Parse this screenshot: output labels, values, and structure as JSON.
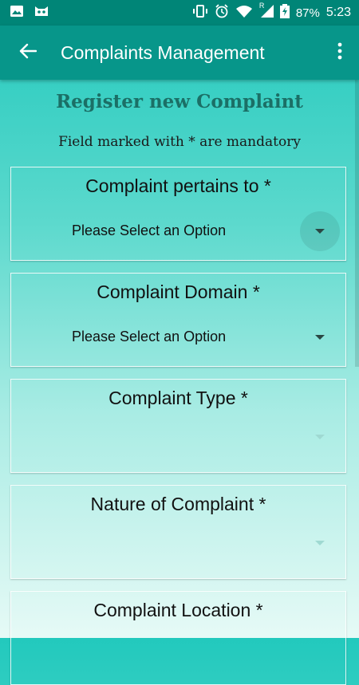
{
  "status_bar": {
    "battery": "87%",
    "time": "5:23",
    "signal_label": "R",
    "icons": [
      "image-icon",
      "cat-app-icon",
      "vibrate-icon",
      "alarm-icon",
      "wifi-icon",
      "signal-icon",
      "battery-charging-icon"
    ]
  },
  "app_bar": {
    "title": "Complaints Management",
    "back_icon": "arrow-back-icon",
    "menu_icon": "more-vertical-icon"
  },
  "form": {
    "heading": "Register new Complaint",
    "subheading": "Field marked with * are mandatory",
    "fields": [
      {
        "label": "Complaint pertains to *",
        "value": "Please Select an Option",
        "enabled": true
      },
      {
        "label": "Complaint Domain *",
        "value": "Please Select an Option",
        "enabled": true
      },
      {
        "label": "Complaint Type *",
        "value": "",
        "enabled": false
      },
      {
        "label": "Nature of Complaint *",
        "value": "",
        "enabled": false
      },
      {
        "label": "Complaint Location *",
        "value": "",
        "enabled": false
      }
    ]
  },
  "colors": {
    "status_bar": "#008577",
    "app_bar": "#07968a",
    "heading": "#1b6f66",
    "background_top": "#22c9bd",
    "background_bottom": "#e6faf6"
  }
}
